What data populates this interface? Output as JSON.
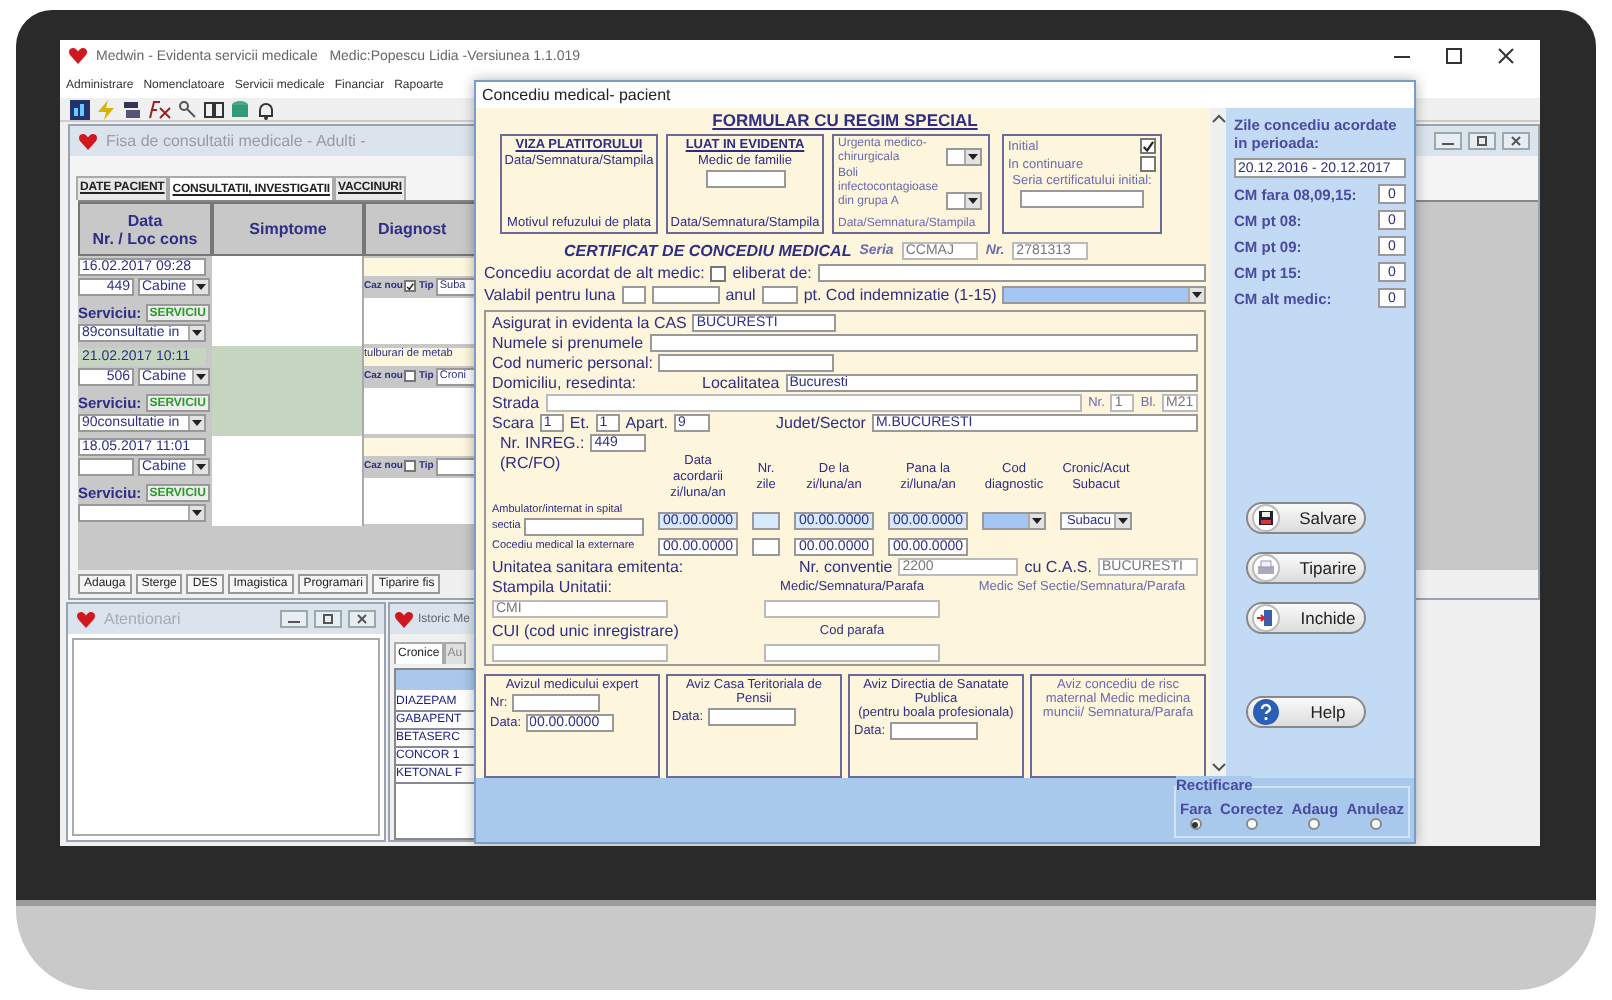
{
  "app": {
    "title": "Medwin - Evidenta servicii medicale   Medic:Popescu Lidia -Versiunea 1.1.019",
    "menu": [
      "Administrare",
      "Nomenclatoare",
      "Servicii medicale",
      "Financiar",
      "Rapoarte"
    ]
  },
  "consult_window": {
    "title": "Fisa de consultatii medicale - Adulti -",
    "tabs": [
      {
        "label": "DATE PACIENT",
        "selected": false
      },
      {
        "label": "CONSULTATII, INVESTIGATII",
        "selected": true
      },
      {
        "label": "VACCINURI",
        "selected": false
      }
    ],
    "columns": [
      "Data\nNr. / Loc cons",
      "Simptome",
      "Diagnost"
    ],
    "rows": [
      {
        "date": "16.02.2017 09:28",
        "nr": "449",
        "loc": "Cabine",
        "service_label": "Serviciu:",
        "service_button": "SERVICIU",
        "service": "89consultatie in",
        "new_case_label": "Caz nou",
        "new_case": true,
        "type_label": "Tip",
        "type": "Suba",
        "selected": false
      },
      {
        "date": "21.02.2017 10:11",
        "nr": "506",
        "loc": "Cabine",
        "service_label": "Serviciu:",
        "service_button": "SERVICIU",
        "service": "90consultatie in",
        "diagnosis": "tulburari de metab",
        "new_case_label": "Caz nou",
        "new_case": false,
        "type_label": "Tip",
        "type": "Croni",
        "selected": true
      },
      {
        "date": "18.05.2017 11:01",
        "loc": "Cabine",
        "service_label": "Serviciu:",
        "service_button": "SERVICIU",
        "new_case_label": "Caz nou",
        "new_case": false,
        "type_label": "Tip",
        "selected": false
      }
    ],
    "buttons": [
      "Adauga",
      "Sterge",
      "DES",
      "Imagistica",
      "Programari",
      "Tiparire fis"
    ]
  },
  "alerts_window": {
    "title": "Atentionari"
  },
  "history_window": {
    "title": "Istoric Me",
    "tabs": [
      {
        "label": "Cronice",
        "selected": true
      },
      {
        "label": "Au",
        "selected": false
      }
    ],
    "items": [
      "DIAZEPAM",
      "GABAPENT",
      "BETASERC",
      "CONCOR 1",
      "KETONAL F"
    ]
  },
  "dialog": {
    "title": "Concediu medical- pacient",
    "heading": "FORMULAR CU REGIM SPECIAL",
    "payer_box": {
      "title": "VIZA PLATITORULUI",
      "signature": "Data/Semnatura/Stampila",
      "refusal": "Motivul refuzului de plata"
    },
    "registration_box": {
      "title": "LUAT IN EVIDENTA",
      "subtitle": "Medic de familie",
      "signature": "Data/Semnatura/Stampila"
    },
    "emergency_box": {
      "emergency": "Urgenta medico-chirurgicala",
      "infectious": "Boli infectocontagioase din grupa A",
      "signature": "Data/Semnatura/Stampila"
    },
    "status_box": {
      "initial": {
        "label": "Initial",
        "checked": true
      },
      "continuation": {
        "label": "In continuare",
        "checked": false
      },
      "initial_series": "Seria certificatului initial:"
    },
    "certificate": {
      "title": "CERTIFICAT DE CONCEDIU MEDICAL",
      "series_label": "Seria",
      "series": "CCMAJ",
      "number_label": "Nr.",
      "number": "2781313"
    },
    "other_doctor": {
      "label": "Concediu acordat de alt medic:",
      "checked": false,
      "issued_by": "eliberat de:"
    },
    "validity": {
      "month_label": "Valabil pentru luna",
      "year_label": "anul",
      "code_label": "pt. Cod indemnizatie (1-15)"
    },
    "patient": {
      "cas_label": "Asigurat in evidenta la CAS",
      "cas": "BUCURESTI",
      "name_label": "Numele si prenumele",
      "cnp_label": "Cod numeric personal:",
      "address_label": "Domiciliu, resedinta:",
      "city_label": "Localitatea",
      "city": "Bucuresti",
      "street_label": "Strada",
      "nr_label": "Nr.",
      "nr": "1",
      "bl_label": "Bl.",
      "bl": "M21",
      "stair_label": "Scara",
      "stair": "1",
      "floor_label": "Et.",
      "floor": "1",
      "apt_label": "Apart.",
      "apt": "9",
      "county_label": "Judet/Sector",
      "county": "M.BUCURESTI",
      "reg_label": "Nr. INREG.:",
      "reg": "449",
      "reg_note": "(RC/FO)"
    },
    "leave_table": {
      "columns": [
        "Data acordarii\nzi/luna/an",
        "Nr.\nzile",
        "De la\nzi/luna/an",
        "Pana la\nzi/luna/an",
        "Cod\ndiagnostic",
        "Cronic/Acut\nSubacut"
      ],
      "rows": [
        {
          "label": "Ambulator/internat in spital",
          "ward_label": "sectia",
          "granted": "00.00.0000",
          "from": "00.00.0000",
          "to": "00.00.0000",
          "chronic": "Subacu"
        },
        {
          "label": "Cocediu medical la externare",
          "granted": "00.00.0000",
          "from": "00.00.0000",
          "to": "00.00.0000"
        }
      ]
    },
    "issuer": {
      "label": "Unitatea sanitara emitenta:",
      "convention_label": "Nr. conventie",
      "convention": "2200",
      "cas_label": "cu C.A.S.",
      "cas": "BUCURESTI",
      "stamp_label": "Stampila Unitatii:",
      "stamp": "CMI",
      "doctor_label": "Medic/Semnatura/Parafa",
      "chief_label": "Medic Sef Sectie/Semnatura/Parafa",
      "cui_label": "CUI (cod unic inregistrare)",
      "code_label": "Cod parafa"
    },
    "approvals": [
      {
        "title": "Avizul medicului expert",
        "fields": [
          {
            "label": "Nr:"
          },
          {
            "label": "Data:",
            "value": "00.00.0000"
          }
        ]
      },
      {
        "title": "Aviz Casa Teritoriala de Pensii",
        "fields": [
          {
            "label": "Data:"
          }
        ]
      },
      {
        "title": "Aviz Directia de Sanatate Publica\n(pentru boala profesionala)",
        "fields": [
          {
            "label": "Data:"
          }
        ]
      },
      {
        "title": "Aviz concediu de risc maternal Medic medicina muncii/ Semnatura/Parafa"
      }
    ],
    "side": {
      "period_label": "Zile concediu acordate in perioada:",
      "period": "20.12.2016 - 20.12.2017",
      "counters": [
        {
          "label": "CM fara 08,09,15:",
          "value": "0"
        },
        {
          "label": "CM pt 08:",
          "value": "0"
        },
        {
          "label": "CM pt 09:",
          "value": "0"
        },
        {
          "label": "CM pt 15:",
          "value": "0"
        },
        {
          "label": "CM alt medic:",
          "value": "0"
        }
      ],
      "buttons": [
        {
          "kind": "save",
          "label": "Salvare"
        },
        {
          "kind": "print",
          "label": "Tiparire"
        },
        {
          "kind": "close",
          "label": "Inchide"
        },
        {
          "kind": "help",
          "label": "Help"
        }
      ]
    },
    "correction": {
      "title": "Rectificare",
      "options": [
        {
          "label": "Fara",
          "selected": true
        },
        {
          "label": "Corectez",
          "selected": false
        },
        {
          "label": "Adaug",
          "selected": false
        },
        {
          "label": "Anuleaz",
          "selected": false
        }
      ]
    }
  }
}
